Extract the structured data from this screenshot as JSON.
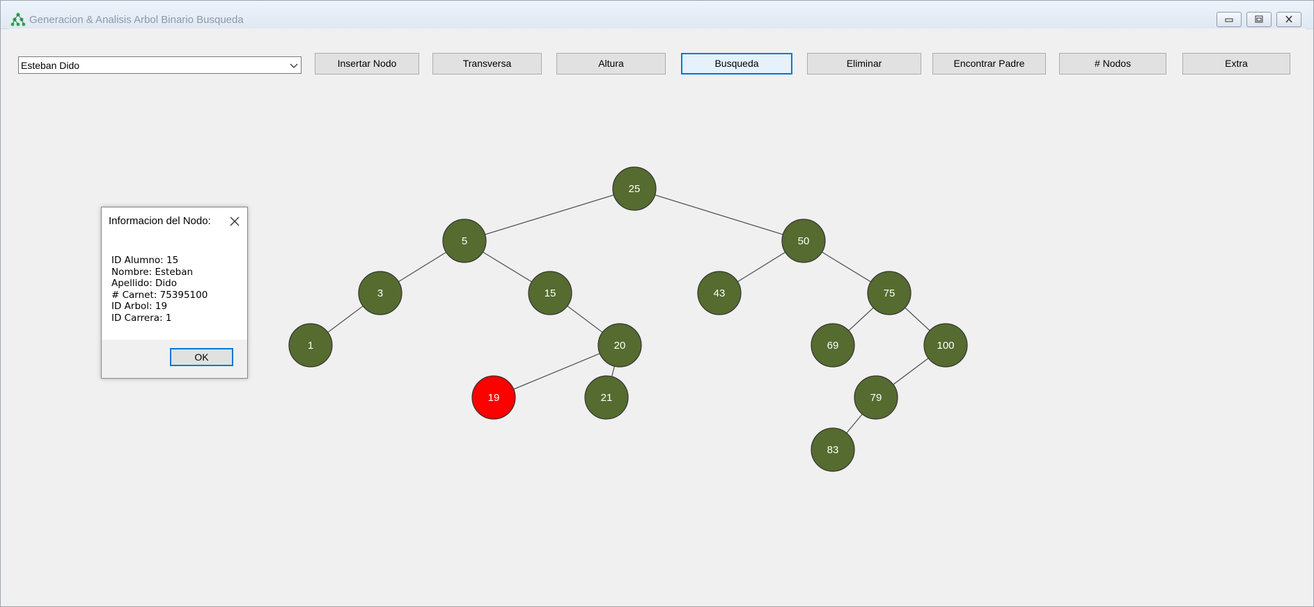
{
  "window": {
    "title": "Generacion & Analisis Arbol Binario Busqueda"
  },
  "toolbar": {
    "student_select": {
      "value": "Esteban Dido"
    },
    "buttons": [
      {
        "label": "Insertar Nodo"
      },
      {
        "label": "Transversa"
      },
      {
        "label": "Altura"
      },
      {
        "label": "Busqueda"
      },
      {
        "label": "Eliminar"
      },
      {
        "label": "Encontrar Padre"
      },
      {
        "label": "# Nodos"
      },
      {
        "label": "Extra"
      }
    ]
  },
  "tree": {
    "nodes": [
      {
        "id": "25",
        "label": "25",
        "highlighted": false
      },
      {
        "id": "5",
        "label": "5",
        "highlighted": false
      },
      {
        "id": "50",
        "label": "50",
        "highlighted": false
      },
      {
        "id": "3",
        "label": "3",
        "highlighted": false
      },
      {
        "id": "15",
        "label": "15",
        "highlighted": false
      },
      {
        "id": "43",
        "label": "43",
        "highlighted": false
      },
      {
        "id": "75",
        "label": "75",
        "highlighted": false
      },
      {
        "id": "1",
        "label": "1",
        "highlighted": false
      },
      {
        "id": "20",
        "label": "20",
        "highlighted": false
      },
      {
        "id": "69",
        "label": "69",
        "highlighted": false
      },
      {
        "id": "100",
        "label": "100",
        "highlighted": false
      },
      {
        "id": "19",
        "label": "19",
        "highlighted": true
      },
      {
        "id": "21",
        "label": "21",
        "highlighted": false
      },
      {
        "id": "79",
        "label": "79",
        "highlighted": false
      },
      {
        "id": "83",
        "label": "83",
        "highlighted": false
      }
    ],
    "edges": [
      [
        "25",
        "5"
      ],
      [
        "25",
        "50"
      ],
      [
        "5",
        "3"
      ],
      [
        "5",
        "15"
      ],
      [
        "50",
        "43"
      ],
      [
        "50",
        "75"
      ],
      [
        "3",
        "1"
      ],
      [
        "15",
        "20"
      ],
      [
        "75",
        "69"
      ],
      [
        "75",
        "100"
      ],
      [
        "20",
        "19"
      ],
      [
        "20",
        "21"
      ],
      [
        "100",
        "79"
      ],
      [
        "79",
        "83"
      ]
    ],
    "colors": {
      "node_fill": "#556b2f",
      "highlight_fill": "#ff0000",
      "edge": "#555555"
    }
  },
  "dialog": {
    "title": "Informacion del Nodo:",
    "lines": [
      "ID Alumno: 15",
      "Nombre: Esteban",
      "Apellido: Dido",
      "# Carnet: 75395100",
      "ID Arbol: 19",
      "ID Carrera: 1"
    ],
    "ok_label": "OK"
  }
}
